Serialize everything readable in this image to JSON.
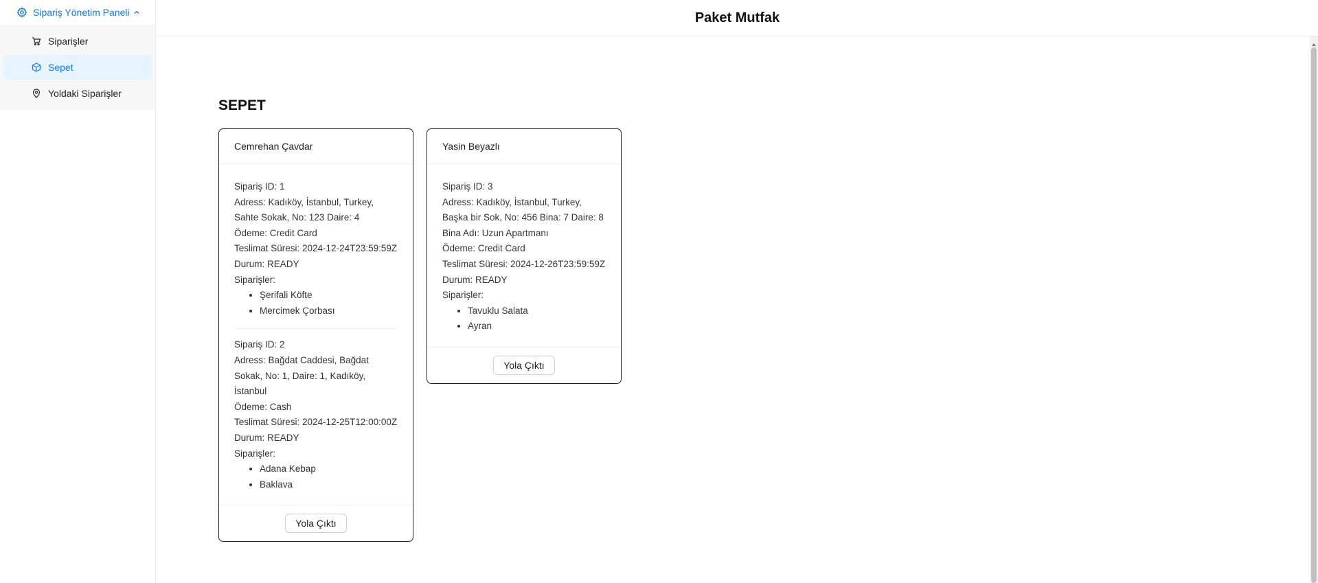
{
  "app": {
    "title": "Paket Mutfak"
  },
  "sidebar": {
    "group_label": "Sipariş Yönetim Paneli",
    "items": [
      {
        "label": "Siparişler",
        "icon": "cart-icon",
        "selected": false
      },
      {
        "label": "Sepet",
        "icon": "cube-icon",
        "selected": true
      },
      {
        "label": "Yoldaki Siparişler",
        "icon": "location-pin-icon",
        "selected": false
      }
    ]
  },
  "main": {
    "title": "SEPET",
    "cards": [
      {
        "customer": "Cemrehan Çavdar",
        "orders": [
          {
            "id_line": "Sipariş ID: 1",
            "address_line": "Adress: Kadıköy, İstanbul, Turkey, Sahte Sokak, No: 123 Daire: 4",
            "payment_line": "Ödeme: Credit Card",
            "delivery_line": "Teslimat Süresi: 2024-12-24T23:59:59Z",
            "status_line": "Durum: READY",
            "items_label": "Siparişler:",
            "items": [
              "Şerifali Köfte",
              "Mercimek Çorbası"
            ]
          },
          {
            "id_line": "Sipariş ID: 2",
            "address_line": "Adress: Bağdat Caddesi, Bağdat Sokak, No: 1, Daire: 1, Kadıköy, İstanbul",
            "payment_line": "Ödeme: Cash",
            "delivery_line": "Teslimat Süresi: 2024-12-25T12:00:00Z",
            "status_line": "Durum: READY",
            "items_label": "Siparişler:",
            "items": [
              "Adana Kebap",
              "Baklava"
            ]
          }
        ],
        "button_label": "Yola Çıktı"
      },
      {
        "customer": "Yasin Beyazlı",
        "orders": [
          {
            "id_line": "Sipariş ID: 3",
            "address_line": "Adress: Kadıköy, İstanbul, Turkey, Başka bir Sok, No: 456 Bina: 7 Daire: 8 Bina Adı: Uzun Apartmanı",
            "payment_line": "Ödeme: Credit Card",
            "delivery_line": "Teslimat Süresi: 2024-12-26T23:59:59Z",
            "status_line": "Durum: READY",
            "items_label": "Siparişler:",
            "items": [
              "Tavuklu Salata",
              "Ayran"
            ]
          }
        ],
        "button_label": "Yola Çıktı"
      }
    ]
  },
  "colors": {
    "accent": "#1677ff",
    "selected_bg": "#e6f4ff",
    "submenu_bg": "#f7f7f7",
    "card_border": "#222222"
  }
}
